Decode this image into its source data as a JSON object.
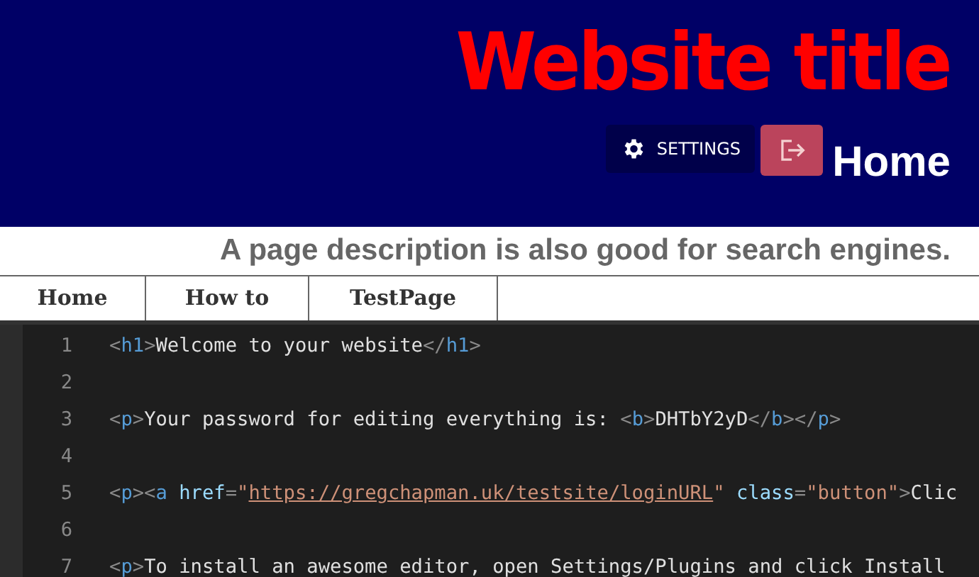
{
  "header": {
    "title": "Website title",
    "settings_button": "SETTINGS",
    "page_name": "Home"
  },
  "description": "A page description is also good for search engines.",
  "nav": [
    {
      "label": "Home"
    },
    {
      "label": "How to"
    },
    {
      "label": "TestPage"
    }
  ],
  "editor": {
    "lines": [
      {
        "number": "1",
        "tokens": [
          {
            "kind": "punct",
            "text": "<"
          },
          {
            "kind": "tag",
            "text": "h1"
          },
          {
            "kind": "punct",
            "text": ">"
          },
          {
            "kind": "text",
            "text": "Welcome to your website"
          },
          {
            "kind": "punct",
            "text": "</"
          },
          {
            "kind": "tag",
            "text": "h1"
          },
          {
            "kind": "punct",
            "text": ">"
          }
        ]
      },
      {
        "number": "2"
      },
      {
        "number": "3",
        "tokens": [
          {
            "kind": "punct",
            "text": "<"
          },
          {
            "kind": "tag",
            "text": "p"
          },
          {
            "kind": "punct",
            "text": ">"
          },
          {
            "kind": "text",
            "text": "Your password for editing everything is: "
          },
          {
            "kind": "punct",
            "text": "<"
          },
          {
            "kind": "tag",
            "text": "b"
          },
          {
            "kind": "punct",
            "text": ">"
          },
          {
            "kind": "text",
            "text": "DHTbY2yD"
          },
          {
            "kind": "punct",
            "text": "</"
          },
          {
            "kind": "tag",
            "text": "b"
          },
          {
            "kind": "punct",
            "text": "></"
          },
          {
            "kind": "tag",
            "text": "p"
          },
          {
            "kind": "punct",
            "text": ">"
          }
        ]
      },
      {
        "number": "4"
      },
      {
        "number": "5",
        "tokens": [
          {
            "kind": "punct",
            "text": "<"
          },
          {
            "kind": "tag",
            "text": "p"
          },
          {
            "kind": "punct",
            "text": "><"
          },
          {
            "kind": "tag",
            "text": "a"
          },
          {
            "kind": "attr",
            "text": " href"
          },
          {
            "kind": "punct",
            "text": "="
          },
          {
            "kind": "string",
            "text": "\""
          },
          {
            "kind": "link",
            "text": "https://gregchapman.uk/testsite/loginURL"
          },
          {
            "kind": "string",
            "text": "\""
          },
          {
            "kind": "attr",
            "text": " class"
          },
          {
            "kind": "punct",
            "text": "="
          },
          {
            "kind": "string",
            "text": "\"button\""
          },
          {
            "kind": "punct",
            "text": ">"
          },
          {
            "kind": "text",
            "text": "Clic"
          }
        ]
      },
      {
        "number": "6"
      },
      {
        "number": "7",
        "tokens": [
          {
            "kind": "punct",
            "text": "<"
          },
          {
            "kind": "tag",
            "text": "p"
          },
          {
            "kind": "punct",
            "text": ">"
          },
          {
            "kind": "text",
            "text": "To install an awesome editor, open Settings/Plugins and click Install"
          }
        ]
      }
    ]
  }
}
